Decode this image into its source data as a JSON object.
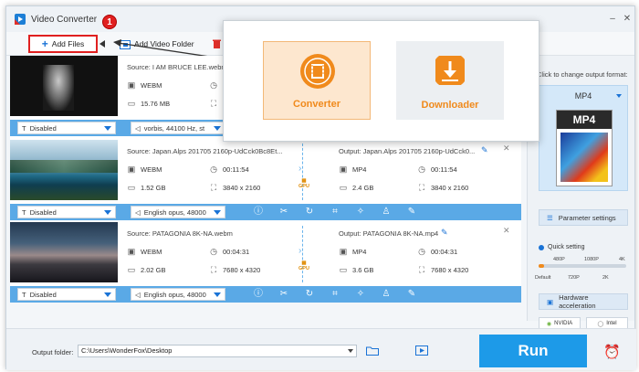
{
  "window": {
    "title": "Video Converter",
    "step_badge": "1"
  },
  "toolbar": {
    "add_files": "Add Files",
    "add_video_folder": "Add Video Folder"
  },
  "popup": {
    "converter": "Converter",
    "downloader": "Downloader"
  },
  "files": [
    {
      "source": "Source: I AM BRUCE LEE.webm",
      "format": "WEBM",
      "size": "15.76 MB",
      "subtitle": "Disabled",
      "audio": "vorbis, 44100 Hz, st"
    },
    {
      "source": "Source: Japan.Alps 201705 2160p-UdCck0Bc8Et...",
      "format": "WEBM",
      "duration": "00:11:54",
      "size": "1.52 GB",
      "resolution": "3840 x 2160",
      "output": "Output: Japan.Alps 201705 2160p-UdCck0...",
      "out_format": "MP4",
      "out_duration": "00:11:54",
      "out_size": "2.4 GB",
      "out_resolution": "3840 x 2160",
      "subtitle": "Disabled",
      "audio": "English opus, 48000"
    },
    {
      "source": "Source: PATAGONIA 8K-NA.webm",
      "format": "WEBM",
      "duration": "00:04:31",
      "size": "2.02 GB",
      "resolution": "7680 x 4320",
      "output": "Output: PATAGONIA 8K-NA.mp4",
      "out_format": "MP4",
      "out_duration": "00:04:31",
      "out_size": "3.6 GB",
      "out_resolution": "7680 x 4320",
      "subtitle": "Disabled",
      "audio": "English opus, 48000"
    }
  ],
  "gpu_label": "GPU",
  "sidebar": {
    "hint": "Click to change output format:",
    "format": "MP4",
    "format_icon_text": "MP4",
    "parameter_settings": "Parameter settings",
    "quick_setting": "Quick setting",
    "ticks_top": [
      "480P",
      "1080P",
      "4K"
    ],
    "ticks_bottom": [
      "Default",
      "720P",
      "2K"
    ],
    "quality_level": 0.06,
    "hardware_acceleration": "Hardware acceleration",
    "nvidia": "NVIDIA",
    "intel": "Intel"
  },
  "bottom": {
    "output_folder_label": "Output folder:",
    "output_folder_value": "C:\\Users\\WonderFox\\Desktop",
    "run": "Run"
  },
  "colors": {
    "accent": "#1d9ae8",
    "orange": "#f08a1c",
    "badge_red": "#e02020"
  }
}
